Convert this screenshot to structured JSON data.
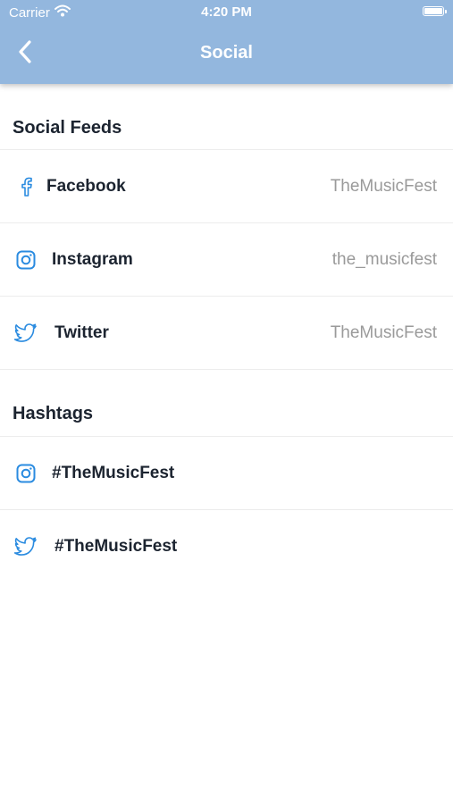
{
  "status_bar": {
    "carrier": "Carrier",
    "time": "4:20 PM"
  },
  "nav": {
    "title": "Social",
    "back_icon": "chevron-left-icon"
  },
  "social_feeds": {
    "title": "Social Feeds",
    "items": [
      {
        "icon": "facebook-icon",
        "label": "Facebook",
        "value": "TheMusicFest"
      },
      {
        "icon": "instagram-icon",
        "label": "Instagram",
        "value": "the_musicfest"
      },
      {
        "icon": "twitter-icon",
        "label": "Twitter",
        "value": "TheMusicFest"
      }
    ]
  },
  "hashtags": {
    "title": "Hashtags",
    "items": [
      {
        "icon": "instagram-icon",
        "label": "#TheMusicFest"
      },
      {
        "icon": "twitter-icon",
        "label": "#TheMusicFest"
      }
    ]
  },
  "colors": {
    "header": "#93b7de",
    "icon_blue": "#2a8be0",
    "text_dark": "#1c2430",
    "text_muted": "#9a9a9a"
  }
}
